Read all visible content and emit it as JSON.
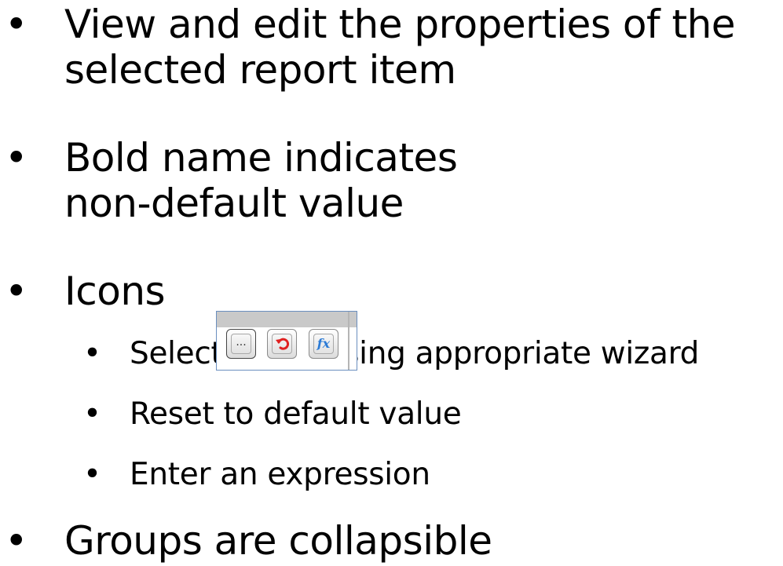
{
  "bullets": {
    "b1_line1": "View and edit the properties of the",
    "b1_line2": "selected report item",
    "b2_line1": "Bold name indicates",
    "b2_line2": "non-default value",
    "b3": "Icons",
    "b3_sub1": "Select value using appropriate wizard",
    "b3_sub2": "Reset to default value",
    "b3_sub3": "Enter an expression",
    "b4": "Groups are collapsible",
    "bullet_char": "•"
  },
  "icons": {
    "ellipsis_label": "...",
    "fx_label": "fx",
    "reset_icon": "undo-arrow-icon",
    "reset_color": "#e02020",
    "fx_color": "#2b7bd6"
  }
}
